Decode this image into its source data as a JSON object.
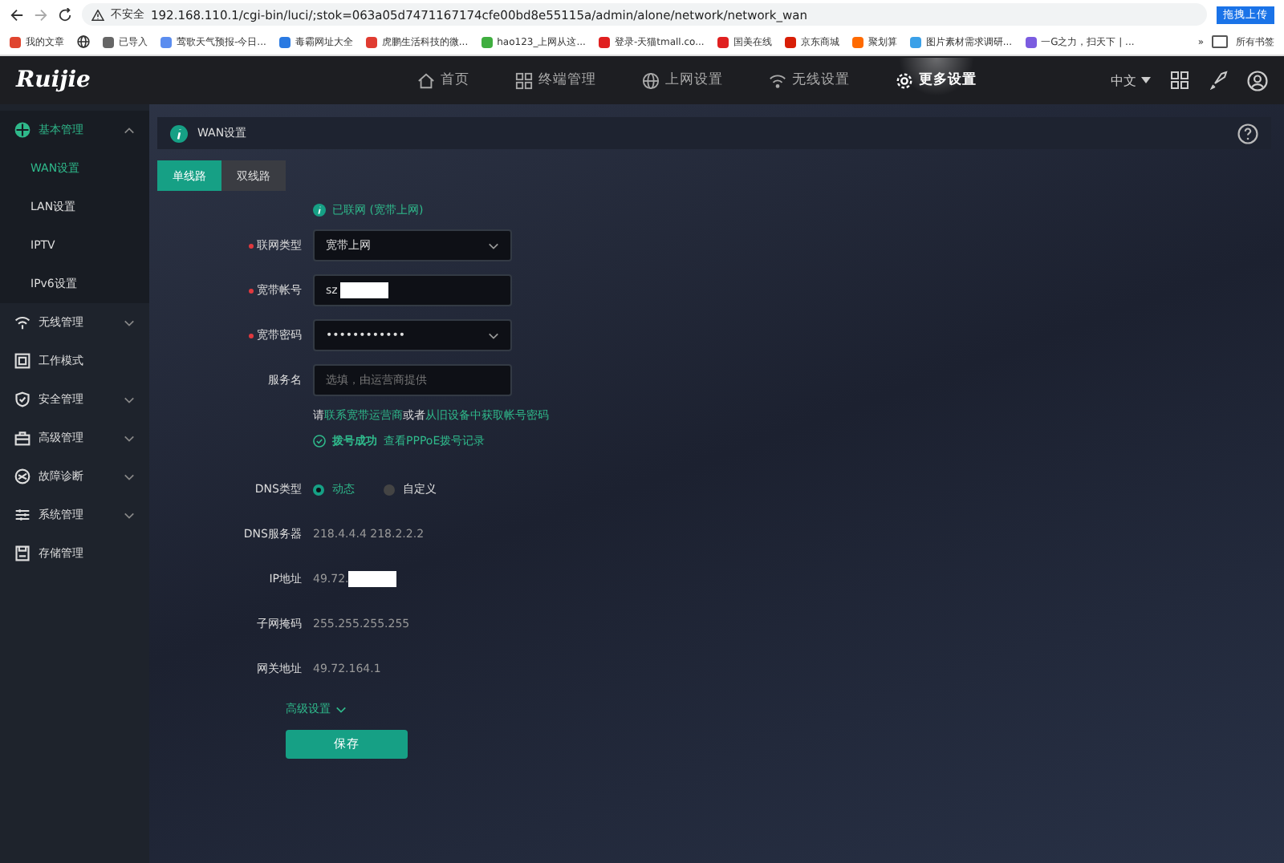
{
  "browser": {
    "security": "不安全",
    "url": "192.168.110.1/cgi-bin/luci/;stok=063a05d7471167174cfe00bd8e55115a/admin/alone/network/network_wan",
    "upload_badge": "拖拽上传",
    "bookmarks": [
      {
        "label": "我的文章",
        "color": "#e0452f"
      },
      {
        "label": "已导入",
        "color": "#666666"
      },
      {
        "label": "莺歌天气预报-今日...",
        "color": "#5b8def"
      },
      {
        "label": "毒霸网址大全",
        "color": "#2a7ae2"
      },
      {
        "label": "虎鹏生活科技的微...",
        "color": "#e03c31"
      },
      {
        "label": "hao123_上网从这...",
        "color": "#3fae3f"
      },
      {
        "label": "登录-天猫tmall.co...",
        "color": "#e02020"
      },
      {
        "label": "国美在线",
        "color": "#e02020"
      },
      {
        "label": "京东商城",
        "color": "#d81e06"
      },
      {
        "label": "聚划算",
        "color": "#ff6a00"
      },
      {
        "label": "图片素材需求调研...",
        "color": "#3aa0e8"
      },
      {
        "label": "一G之力，扫天下 | ...",
        "color": "#7b5ce0"
      }
    ],
    "more": "»",
    "all_bookmarks": "所有书签"
  },
  "nav": {
    "logo": "Ruijie",
    "items": [
      {
        "label": "首页",
        "selected": false
      },
      {
        "label": "终端管理",
        "selected": false
      },
      {
        "label": "上网设置",
        "selected": false
      },
      {
        "label": "无线设置",
        "selected": false
      },
      {
        "label": "更多设置",
        "selected": true
      }
    ],
    "language": "中文"
  },
  "sidebar": {
    "items": [
      {
        "label": "基本管理",
        "kind": "group",
        "expanded": true,
        "children": [
          {
            "label": "WAN设置",
            "selected": true
          },
          {
            "label": "LAN设置",
            "selected": false
          },
          {
            "label": "IPTV",
            "selected": false
          },
          {
            "label": "IPv6设置",
            "selected": false
          }
        ]
      },
      {
        "label": "无线管理",
        "kind": "group",
        "expanded": false
      },
      {
        "label": "工作模式",
        "kind": "page"
      },
      {
        "label": "安全管理",
        "kind": "group",
        "expanded": false
      },
      {
        "label": "高级管理",
        "kind": "group",
        "expanded": false
      },
      {
        "label": "故障诊断",
        "kind": "group",
        "expanded": false
      },
      {
        "label": "系统管理",
        "kind": "group",
        "expanded": false
      },
      {
        "label": "存储管理",
        "kind": "page"
      }
    ]
  },
  "page": {
    "title": "WAN设置",
    "tabs": [
      {
        "label": "单线路",
        "selected": true
      },
      {
        "label": "双线路",
        "selected": false
      }
    ],
    "status": "已联网 (宽带上网)",
    "fields": [
      {
        "kind": "select",
        "label": "联网类型",
        "required": true,
        "value": "宽带上网"
      },
      {
        "kind": "text",
        "label": "宽带帐号",
        "required": true,
        "value": "sz",
        "redacted": true
      },
      {
        "kind": "password",
        "label": "宽带密码",
        "required": true,
        "value": "••••••••••••"
      },
      {
        "kind": "text",
        "label": "服务名",
        "required": false,
        "placeholder": "选填，由运营商提供"
      }
    ],
    "hint": "请**联系宽带运营商**或者**从旧设备中获取帐号密码**",
    "dial_status": "拨号成功",
    "dial_link": "查看PPPoE拨号记录",
    "dns_type": {
      "label": "DNS类型",
      "options": [
        {
          "label": "动态",
          "selected": true
        },
        {
          "label": "自定义",
          "selected": false
        }
      ]
    },
    "info": [
      {
        "label": "DNS服务器",
        "value": "218.4.4.4 218.2.2.2",
        "redacted": false
      },
      {
        "label": "IP地址",
        "value": "49.72.",
        "redacted": true
      },
      {
        "label": "子网掩码",
        "value": "255.255.255.255",
        "redacted": false
      },
      {
        "label": "网关地址",
        "value": "49.72.164.1",
        "redacted": false
      }
    ],
    "advanced": "高级设置",
    "save": "保存"
  }
}
